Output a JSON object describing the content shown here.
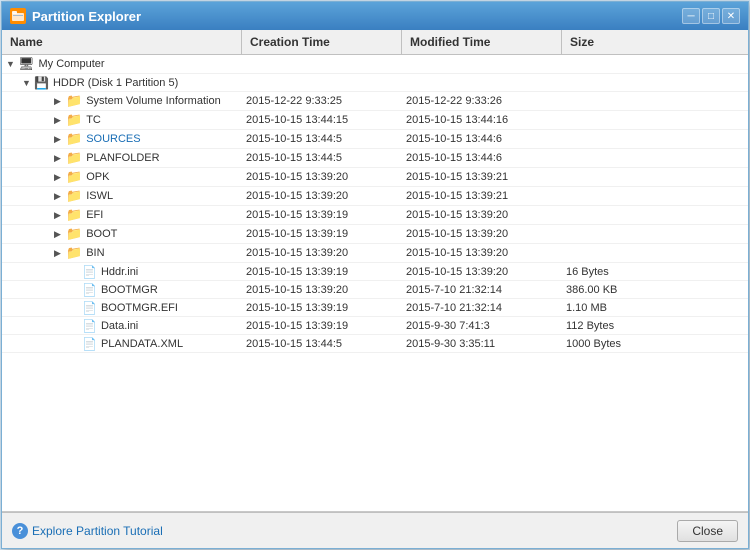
{
  "window": {
    "title": "Partition Explorer",
    "title_icon": "🗂",
    "minimize_label": "─",
    "maximize_label": "□",
    "close_label": "✕"
  },
  "columns": {
    "name": "Name",
    "creation": "Creation Time",
    "modified": "Modified Time",
    "size": "Size"
  },
  "tree": {
    "root": "My Computer",
    "hddr": "HDDR (Disk 1 Partition 5)",
    "items": [
      {
        "name": "System Volume Information",
        "indent": "indent4",
        "creation": "2015-12-22 9:33:25",
        "modified": "2015-12-22 9:33:26",
        "size": "",
        "type": "folder",
        "expand": true
      },
      {
        "name": "TC",
        "indent": "indent4",
        "creation": "2015-10-15 13:44:15",
        "modified": "2015-10-15 13:44:16",
        "size": "",
        "type": "folder",
        "expand": true
      },
      {
        "name": "SOURCES",
        "indent": "indent4",
        "creation": "2015-10-15 13:44:5",
        "modified": "2015-10-15 13:44:6",
        "size": "",
        "type": "folder",
        "expand": true,
        "blue": true
      },
      {
        "name": "PLANFOLDER",
        "indent": "indent4",
        "creation": "2015-10-15 13:44:5",
        "modified": "2015-10-15 13:44:6",
        "size": "",
        "type": "folder",
        "expand": true
      },
      {
        "name": "OPK",
        "indent": "indent4",
        "creation": "2015-10-15 13:39:20",
        "modified": "2015-10-15 13:39:21",
        "size": "",
        "type": "folder",
        "expand": true
      },
      {
        "name": "ISWL",
        "indent": "indent4",
        "creation": "2015-10-15 13:39:20",
        "modified": "2015-10-15 13:39:21",
        "size": "",
        "type": "folder",
        "expand": true
      },
      {
        "name": "EFI",
        "indent": "indent4",
        "creation": "2015-10-15 13:39:19",
        "modified": "2015-10-15 13:39:20",
        "size": "",
        "type": "folder",
        "expand": true
      },
      {
        "name": "BOOT",
        "indent": "indent4",
        "creation": "2015-10-15 13:39:19",
        "modified": "2015-10-15 13:39:20",
        "size": "",
        "type": "folder",
        "expand": true
      },
      {
        "name": "BIN",
        "indent": "indent4",
        "creation": "2015-10-15 13:39:20",
        "modified": "2015-10-15 13:39:20",
        "size": "",
        "type": "folder",
        "expand": true
      },
      {
        "name": "Hddr.ini",
        "indent": "indent5",
        "creation": "2015-10-15 13:39:19",
        "modified": "2015-10-15 13:39:20",
        "size": "16 Bytes",
        "type": "file",
        "expand": false
      },
      {
        "name": "BOOTMGR",
        "indent": "indent5",
        "creation": "2015-10-15 13:39:20",
        "modified": "2015-7-10 21:32:14",
        "size": "386.00 KB",
        "type": "file",
        "expand": false
      },
      {
        "name": "BOOTMGR.EFI",
        "indent": "indent5",
        "creation": "2015-10-15 13:39:19",
        "modified": "2015-7-10 21:32:14",
        "size": "1.10 MB",
        "type": "file",
        "expand": false
      },
      {
        "name": "Data.ini",
        "indent": "indent5",
        "creation": "2015-10-15 13:39:19",
        "modified": "2015-9-30 7:41:3",
        "size": "112 Bytes",
        "type": "file",
        "expand": false
      },
      {
        "name": "PLANDATA.XML",
        "indent": "indent5",
        "creation": "2015-10-15 13:44:5",
        "modified": "2015-9-30 3:35:11",
        "size": "1000 Bytes",
        "type": "file",
        "expand": false
      }
    ]
  },
  "bottom": {
    "tutorial_label": "Explore Partition Tutorial",
    "close_label": "Close",
    "help_icon": "?"
  }
}
